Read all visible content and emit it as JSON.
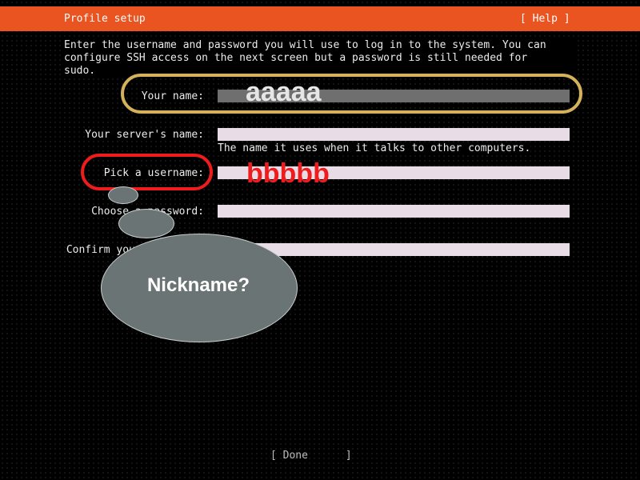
{
  "header": {
    "title": "Profile setup",
    "help_label": "[ Help ]"
  },
  "intro": "Enter the username and password you will use to log in to the system. You can\nconfigure SSH access on the next screen but a password is still needed for\nsudo.",
  "form": {
    "your_name": {
      "label": "Your name:",
      "value": ""
    },
    "server_name": {
      "label": "Your server's name:",
      "value": "",
      "hint": "The name it uses when it talks to other computers."
    },
    "username": {
      "label": "Pick a username:",
      "value": ""
    },
    "password": {
      "label": "Choose a password:",
      "value": ""
    },
    "confirm_password": {
      "label": "Confirm your password:",
      "value": ""
    }
  },
  "done_label": "[ Done      ]",
  "annotations": {
    "name_text": "aaaaa",
    "username_text": "bbbbb",
    "bubble_text": "Nickname?",
    "colors": {
      "gold": "#d4b15a",
      "red": "#ee1c1c",
      "bubble": "#6b7474"
    }
  },
  "colors": {
    "header": "#e95420",
    "field": "#e8dce6",
    "active_field": "#6f6f6f"
  }
}
